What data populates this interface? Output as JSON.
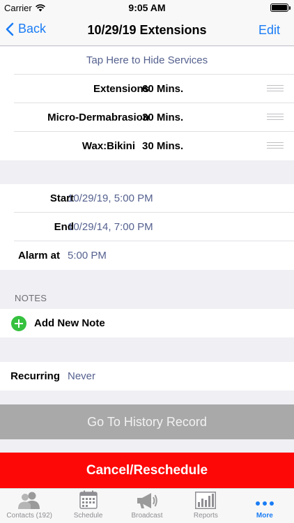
{
  "status_bar": {
    "carrier": "Carrier",
    "time": "9:05 AM"
  },
  "nav": {
    "back_label": "Back",
    "title": "10/29/19 Extensions",
    "edit_label": "Edit"
  },
  "services": {
    "toggle_label": "Tap Here to Hide Services",
    "items": [
      {
        "name": "Extensions",
        "duration": "60 Mins."
      },
      {
        "name": "Micro-Dermabrasion",
        "duration": "30 Mins."
      },
      {
        "name": "Wax:Bikini",
        "duration": "30 Mins."
      }
    ]
  },
  "schedule": {
    "start_label": "Start",
    "start_value": "10/29/19, 5:00 PM",
    "end_label": "End",
    "end_value": "10/29/14, 7:00 PM",
    "alarm_label": "Alarm at",
    "alarm_value": "5:00 PM"
  },
  "notes": {
    "header": "NOTES",
    "add_label": "Add New Note"
  },
  "recurring": {
    "label": "Recurring",
    "value": "Never"
  },
  "buttons": {
    "history": "Go To History Record",
    "cancel": "Cancel/Reschedule"
  },
  "tabs": [
    {
      "label": "Contacts (192)",
      "icon": "contacts-icon"
    },
    {
      "label": "Schedule",
      "icon": "calendar-icon"
    },
    {
      "label": "Broadcast",
      "icon": "megaphone-icon"
    },
    {
      "label": "Reports",
      "icon": "bar-chart-icon"
    },
    {
      "label": "More",
      "icon": "more-dots-icon",
      "active": true
    }
  ],
  "colors": {
    "accent": "#1a7cf5",
    "danger": "#fe0707",
    "value_text": "#55618f",
    "add_green": "#36c13f",
    "disabled_button": "#a9a9a9"
  }
}
